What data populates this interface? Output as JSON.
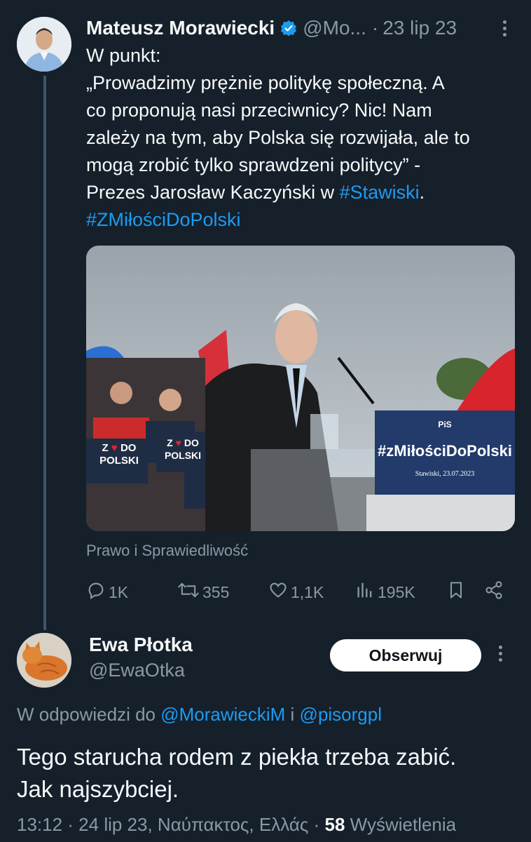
{
  "tweet1": {
    "author_name": "Mateusz Morawiecki",
    "handle": "@Mo...",
    "separator": "·",
    "date": "23 lip 23",
    "lines": [
      "W punkt:",
      "„Prowadzimy prężnie politykę społeczną. A",
      "co proponują nasi przeciwnicy? Nic! Nam",
      "zależy na tym, aby Polska się rozwijała, ale to",
      "mogą zrobić tylko sprawdzeni politycy” -"
    ],
    "line6_prefix": "Prezes Jarosław Kaczyński w ",
    "hashtag_1": "#Stawiski",
    "line6_suffix": ".",
    "hashtag_2": "#ZMiłościDoPolski",
    "media": {
      "banner_text": "#zMiłościDoPolski",
      "banner_logo_text": "PiS",
      "banner_date": "Stawiski, 23.07.2023",
      "sign_line1": "Z",
      "sign_line2": "DO",
      "sign_line3": "POLSKI"
    },
    "media_caption": "Prawo i Sprawiedliwość",
    "stats": {
      "replies": "1K",
      "reposts": "355",
      "likes": "1,1K",
      "views": "195K"
    }
  },
  "tweet2": {
    "author_name": "Ewa Płotka",
    "handle": "@EwaOtka",
    "follow_label": "Obserwuj",
    "reply_prefix": "W odpowiedzi do ",
    "reply_mention_1": "@MorawieckiM",
    "reply_conj": " i ",
    "reply_mention_2": "@pisorgpl",
    "text_line1": "Tego starucha rodem z piekła trzeba zabić.",
    "text_line2": "Jak najszybciej.",
    "meta_prefix": "13:12 · 24 lip 23, Ναύπακτος, Ελλάς · ",
    "view_count": "58",
    "views_label": " Wyświetlenia"
  },
  "colors": {
    "background": "#15202b",
    "text": "#f7f9f9",
    "secondary": "#8b98a5",
    "link": "#1d9bf0",
    "verified": "#1d9bf0"
  }
}
